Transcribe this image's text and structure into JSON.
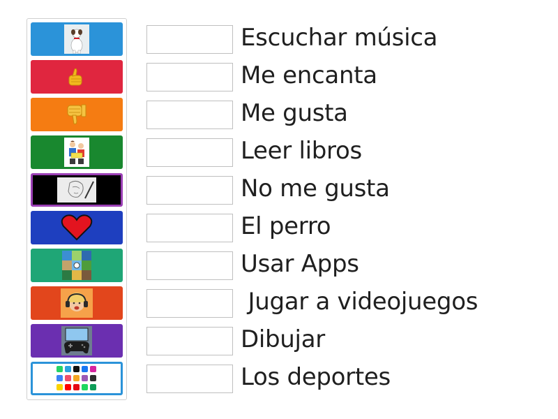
{
  "tiles": [
    {
      "image": "dog-icon",
      "color": "#2b93d9"
    },
    {
      "image": "thumbs-up-icon",
      "color": "#e0263f"
    },
    {
      "image": "thumbs-down-icon",
      "color": "#f57c12"
    },
    {
      "image": "reading-kids-icon",
      "color": "#19882f"
    },
    {
      "image": "drawing-icon",
      "color": "#000000",
      "border": "#9b3fb5"
    },
    {
      "image": "heart-icon",
      "color": "#1e3fbf"
    },
    {
      "image": "sports-collage-icon",
      "color": "#1fa676"
    },
    {
      "image": "headphones-girl-icon",
      "color": "#e2461c"
    },
    {
      "image": "gamepad-icon",
      "color": "#6b2fb0"
    },
    {
      "image": "apps-grid-icon",
      "color": "#ffffff",
      "border": "#2b93d9"
    }
  ],
  "labels": [
    "Escuchar música",
    "Me encanta",
    "Me gusta",
    "Leer libros",
    "No me gusta",
    "El perro",
    "Usar Apps",
    " Jugar a videojuegos",
    "Dibujar",
    "Los deportes"
  ]
}
